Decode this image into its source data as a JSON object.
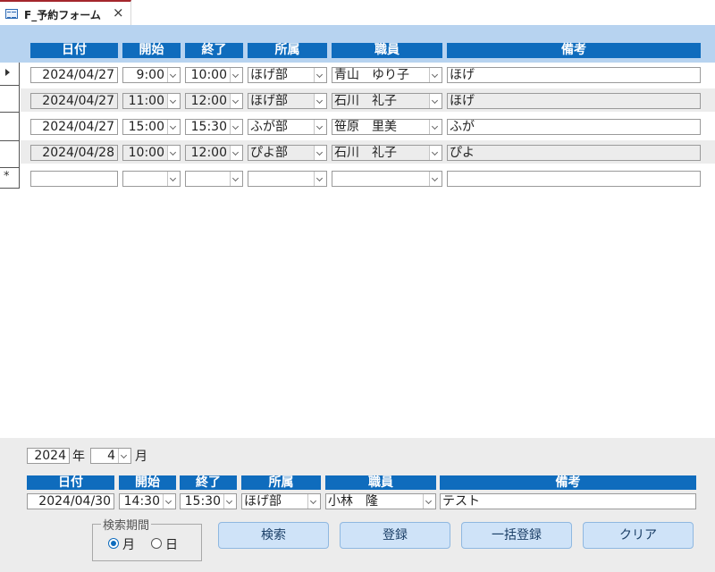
{
  "tab": {
    "title": "F_予約フォーム",
    "close": "×"
  },
  "columns": [
    "日付",
    "開始",
    "終了",
    "所属",
    "職員",
    "備考"
  ],
  "rows": [
    {
      "date": "2024/04/27",
      "start": "9:00",
      "end": "10:00",
      "dept": "ほげ部",
      "staff": "青山　ゆり子",
      "note": "ほげ"
    },
    {
      "date": "2024/04/27",
      "start": "11:00",
      "end": "12:00",
      "dept": "ほげ部",
      "staff": "石川　礼子",
      "note": "ほげ"
    },
    {
      "date": "2024/04/27",
      "start": "15:00",
      "end": "15:30",
      "dept": "ふが部",
      "staff": "笹原　里美",
      "note": "ふが"
    },
    {
      "date": "2024/04/28",
      "start": "10:00",
      "end": "12:00",
      "dept": "ぴよ部",
      "staff": "石川　礼子",
      "note": "ぴよ"
    }
  ],
  "new_row_marker": "*",
  "footer": {
    "year": "2024",
    "year_label": "年",
    "month": "4",
    "month_label": "月",
    "columns": [
      "日付",
      "開始",
      "終了",
      "所属",
      "職員",
      "備考"
    ],
    "entry": {
      "date": "2024/04/30",
      "start": "14:30",
      "end": "15:30",
      "dept": "ほげ部",
      "staff": "小林　隆",
      "note": "テスト"
    },
    "search_period": {
      "label": "検索期間",
      "options": [
        "月",
        "日"
      ],
      "selected": "月"
    },
    "buttons": {
      "search": "検索",
      "register": "登録",
      "bulk_register": "一括登録",
      "clear": "クリア"
    }
  },
  "colors": {
    "header_blue": "#0f6cbd",
    "band_blue": "#b7d3f0",
    "button_bg": "#cfe3f8",
    "tab_accent": "#a4262c"
  }
}
